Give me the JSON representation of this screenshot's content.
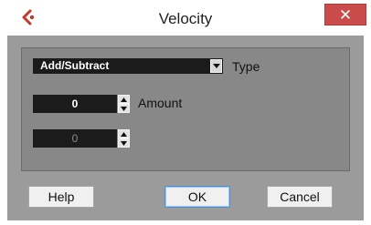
{
  "window": {
    "title": "Velocity",
    "close_symbol": "✕",
    "app_icon": "cubase-logo-icon",
    "accent": "#c0392b"
  },
  "type_field": {
    "value": "Add/Subtract",
    "label": "Type"
  },
  "amount_field": {
    "value": "0",
    "label": "Amount"
  },
  "third_field": {
    "value": "0",
    "label": ""
  },
  "buttons": {
    "help": "Help",
    "ok": "OK",
    "cancel": "Cancel"
  }
}
